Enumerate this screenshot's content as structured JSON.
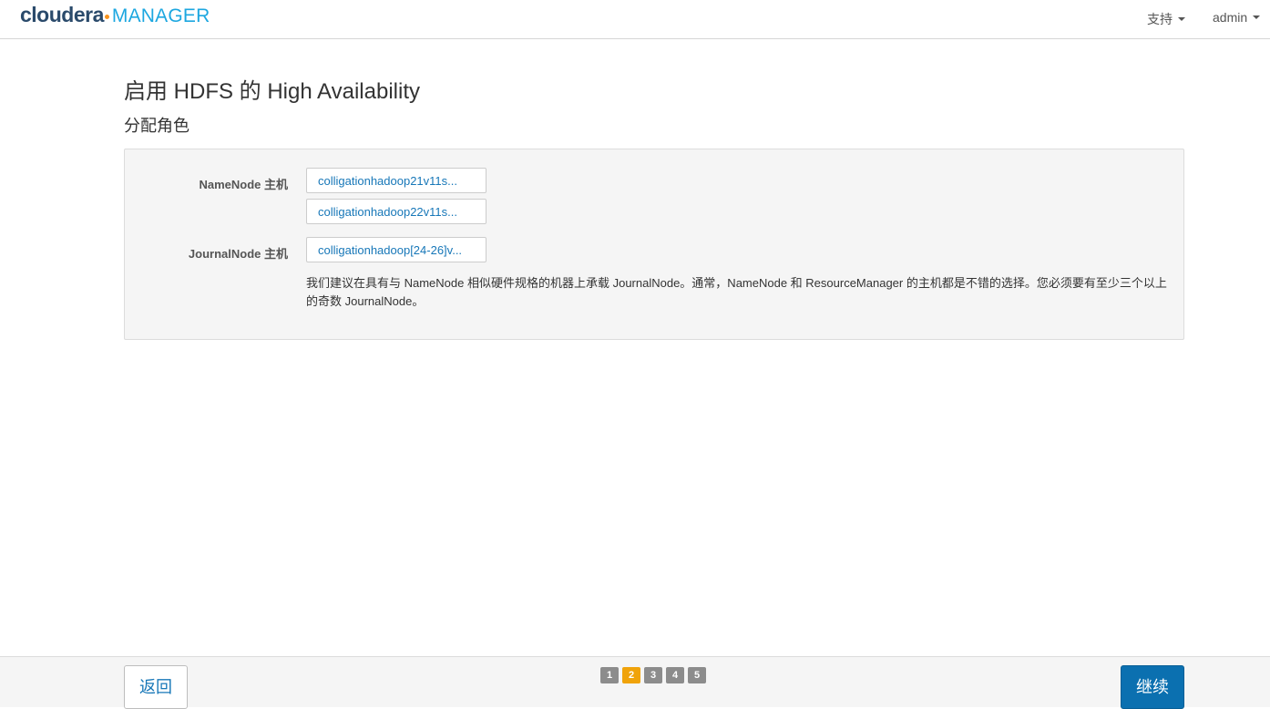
{
  "header": {
    "logo_brand": "cloudera",
    "logo_product": "MANAGER",
    "support_menu": "支持",
    "user_menu": "admin"
  },
  "main": {
    "title": "启用 HDFS 的 High Availability",
    "subtitle": "分配角色",
    "namenode_label": "NameNode 主机",
    "namenode_hosts": [
      "colligationhadoop21v11s...",
      "colligationhadoop22v11s..."
    ],
    "journalnode_label": "JournalNode 主机",
    "journalnode_hosts": [
      "colligationhadoop[24-26]v..."
    ],
    "help_text": "我们建议在具有与 NameNode 相似硬件规格的机器上承载 JournalNode。通常，NameNode 和 ResourceManager 的主机都是不错的选择。您必须要有至少三个以上的奇数 JournalNode。"
  },
  "footer": {
    "back_label": "返回",
    "continue_label": "继续",
    "steps": [
      "1",
      "2",
      "3",
      "4",
      "5"
    ],
    "current_step": 2
  },
  "colors": {
    "brand_dark": "#2a4a6b",
    "brand_light": "#1da7e0",
    "active_step": "#f0a30a",
    "primary_button": "#0b70b0",
    "link": "#1777b8"
  }
}
